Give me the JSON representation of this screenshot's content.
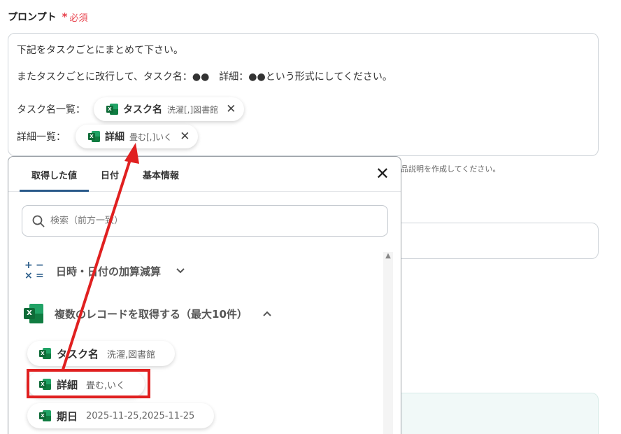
{
  "field": {
    "label": "プロンプト",
    "required_star": "*",
    "required_text": "必須"
  },
  "prompt": {
    "line1": "下記をタスクごとにまとめて下さい。",
    "line2": "またタスクごとに改行して、タスク名：●●　詳細：●●という形式にしてください。",
    "var1_label": "タスク名一覧：",
    "var1_chip_name": "タスク名",
    "var1_chip_value": "洗濯[,]図書館",
    "var2_label": "詳細一覧：",
    "var2_chip_name": "詳細",
    "var2_chip_value": "畳む[,]いく",
    "chip_close": "✕"
  },
  "hint_text": "品説明を作成してください。",
  "dropdown": {
    "tabs": [
      "取得した値",
      "日付",
      "基本情報"
    ],
    "active_tab": 0,
    "close": "✕",
    "search_placeholder": "検索（前方一致）",
    "section_calc": "日時・日付の加算減算",
    "section_calc_chevron": "⌄",
    "section_records": "複数のレコードを取得する（最大10件）",
    "section_records_chevron": "^",
    "items": [
      {
        "name": "タスク名",
        "value": "洗濯,図書館"
      },
      {
        "name": "詳細",
        "value": "畳む,いく"
      },
      {
        "name": "期日",
        "value": "2025-11-25,2025-11-25"
      }
    ]
  },
  "icons": {
    "excel_badge": "X",
    "search_icon": "search-icon",
    "calc_plus": "+",
    "calc_minus": "−",
    "calc_times": "×",
    "calc_equals": "=",
    "scroll_up": "▲"
  },
  "colors": {
    "required": "#e8434e",
    "accent": "#2a5a8a",
    "excel_green": "#21a366",
    "annotation_red": "#e02020"
  }
}
